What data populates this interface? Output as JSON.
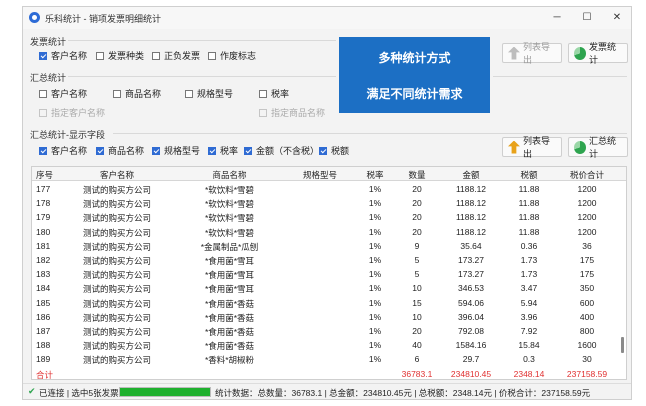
{
  "window": {
    "title": "乐科统计 - 销项发票明细统计",
    "minimize": "─",
    "maximize": "☐",
    "close": "✕"
  },
  "invoice_stats": {
    "label": "发票统计",
    "options": [
      {
        "label": "客户名称",
        "checked": true
      },
      {
        "label": "发票种类",
        "checked": false
      },
      {
        "label": "正负发票",
        "checked": false
      },
      {
        "label": "作废标志",
        "checked": false
      }
    ],
    "export_button": "列表导出",
    "stats_button": "发票统计"
  },
  "summary_stats": {
    "label": "汇总统计",
    "options": [
      {
        "label": "客户名称",
        "checked": false
      },
      {
        "label": "商品名称",
        "checked": false
      },
      {
        "label": "规格型号",
        "checked": false
      },
      {
        "label": "税率",
        "checked": false
      }
    ],
    "specify": [
      {
        "label": "指定客户名称",
        "checked": false
      },
      {
        "label": "指定商品名称",
        "checked": false
      }
    ]
  },
  "display_fields": {
    "label": "汇总统计-显示字段",
    "options": [
      {
        "label": "客户名称",
        "checked": true
      },
      {
        "label": "商品名称",
        "checked": true
      },
      {
        "label": "规格型号",
        "checked": true
      },
      {
        "label": "税率",
        "checked": true
      },
      {
        "label": "金额（不含税）",
        "checked": true
      },
      {
        "label": "税额",
        "checked": true
      }
    ],
    "export_button": "列表导出",
    "stats_button": "汇总统计"
  },
  "banner": {
    "line1": "多种统计方式",
    "line2": "满足不同统计需求"
  },
  "table": {
    "headers": [
      "序号",
      "客户名称",
      "商品名称",
      "规格型号",
      "税率",
      "数量",
      "金额",
      "税额",
      "税价合计"
    ],
    "rows": [
      [
        "177",
        "测试的购买方公司",
        "*软饮料*雪碧",
        "",
        "1%",
        "20",
        "1188.12",
        "11.88",
        "1200"
      ],
      [
        "178",
        "测试的购买方公司",
        "*软饮料*雪碧",
        "",
        "1%",
        "20",
        "1188.12",
        "11.88",
        "1200"
      ],
      [
        "179",
        "测试的购买方公司",
        "*软饮料*雪碧",
        "",
        "1%",
        "20",
        "1188.12",
        "11.88",
        "1200"
      ],
      [
        "180",
        "测试的购买方公司",
        "*软饮料*雪碧",
        "",
        "1%",
        "20",
        "1188.12",
        "11.88",
        "1200"
      ],
      [
        "181",
        "测试的购买方公司",
        "*金属制品*瓜刨",
        "",
        "1%",
        "9",
        "35.64",
        "0.36",
        "36"
      ],
      [
        "182",
        "测试的购买方公司",
        "*食用菌*雪耳",
        "",
        "1%",
        "5",
        "173.27",
        "1.73",
        "175"
      ],
      [
        "183",
        "测试的购买方公司",
        "*食用菌*雪耳",
        "",
        "1%",
        "5",
        "173.27",
        "1.73",
        "175"
      ],
      [
        "184",
        "测试的购买方公司",
        "*食用菌*雪耳",
        "",
        "1%",
        "10",
        "346.53",
        "3.47",
        "350"
      ],
      [
        "185",
        "测试的购买方公司",
        "*食用菌*香菇",
        "",
        "1%",
        "15",
        "594.06",
        "5.94",
        "600"
      ],
      [
        "186",
        "测试的购买方公司",
        "*食用菌*香菇",
        "",
        "1%",
        "10",
        "396.04",
        "3.96",
        "400"
      ],
      [
        "187",
        "测试的购买方公司",
        "*食用菌*香菇",
        "",
        "1%",
        "20",
        "792.08",
        "7.92",
        "800"
      ],
      [
        "188",
        "测试的购买方公司",
        "*食用菌*香菇",
        "",
        "1%",
        "40",
        "1584.16",
        "15.84",
        "1600"
      ],
      [
        "189",
        "测试的购买方公司",
        "*香料*胡椒粉",
        "",
        "1%",
        "6",
        "29.7",
        "0.3",
        "30"
      ]
    ],
    "total": [
      "合计",
      "",
      "",
      "",
      "",
      "36783.1",
      "234810.45",
      "2348.14",
      "237158.59"
    ]
  },
  "status": {
    "left": "已连接 | 选中5张发票",
    "right": "统计数据：总数量：36783.1 | 总金额：234810.45元 | 总税额：2348.14元 | 价税合计：237158.59元",
    "progress": 1.0
  },
  "colors": {
    "accent": "#2f6bd3",
    "banner": "#1c6fc4",
    "total_text": "#e03030",
    "progress": "#1fb02e"
  }
}
